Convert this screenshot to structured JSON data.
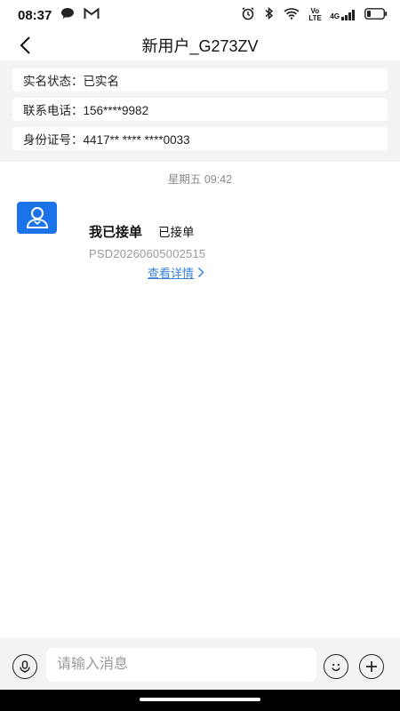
{
  "status_bar": {
    "time": "08:37",
    "icons_left": [
      "chat-bubble-icon",
      "gmail-icon"
    ],
    "icons_right": [
      "alarm-icon",
      "bluetooth-icon",
      "wifi-icon",
      "volte-icon",
      "signal-4g-icon",
      "battery-icon"
    ],
    "volte_label": "Vo LTE",
    "network_label": "4G"
  },
  "header": {
    "title": "新用户_G273ZV"
  },
  "info": [
    {
      "text": "实名状态：已实名"
    },
    {
      "text": "联系电话：156****9982"
    },
    {
      "text": "身份证号：4417** **** ****0033"
    }
  ],
  "chat": {
    "timestamp": "星期五 09:42",
    "message": {
      "title": "我已接单",
      "status": "已接单",
      "order_no": "PSD20260605002515",
      "detail_link": "查看详情"
    }
  },
  "input_bar": {
    "placeholder": "请输入消息"
  },
  "colors": {
    "accent": "#1a73e8",
    "link": "#3b82d6",
    "panel_bg": "#f2f3f5"
  }
}
